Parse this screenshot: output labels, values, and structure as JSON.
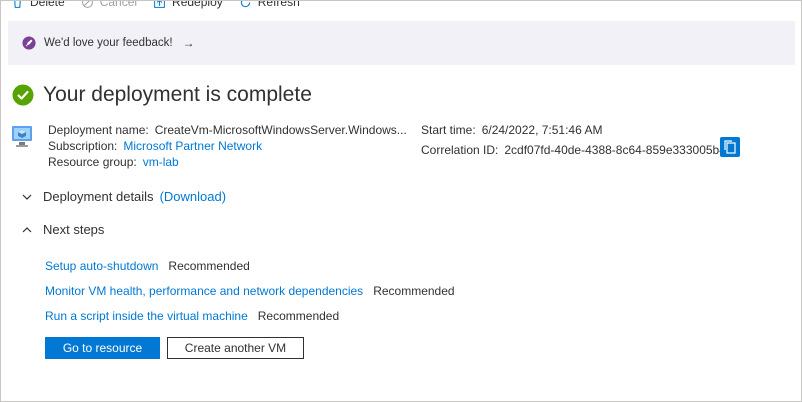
{
  "toolbar": {
    "items": [
      {
        "label": "Delete",
        "icon": "trash-icon",
        "enabled": true
      },
      {
        "label": "Cancel",
        "icon": "cancel-icon",
        "enabled": false
      },
      {
        "label": "Redeploy",
        "icon": "upload-icon",
        "enabled": true
      },
      {
        "label": "Refresh",
        "icon": "refresh-icon",
        "enabled": true
      }
    ]
  },
  "banner": {
    "text": "We'd love your feedback!",
    "arrow": "→",
    "icon": "rocket-icon"
  },
  "status": {
    "title": "Your deployment is complete",
    "icon": "success-check-icon",
    "color": "#57a300"
  },
  "deployment": {
    "name_label": "Deployment name:",
    "name_value": "CreateVm-MicrosoftWindowsServer.Windows...",
    "subscription_label": "Subscription:",
    "subscription_value": "Microsoft Partner Network",
    "resource_group_label": "Resource group:",
    "resource_group_value": "vm-lab",
    "start_time_label": "Start time:",
    "start_time_value": "6/24/2022, 7:51:46 AM",
    "correlation_label": "Correlation ID:",
    "correlation_value": "2cdf07fd-40de-4388-8c64-859e333005b4"
  },
  "sections": {
    "details_label": "Deployment details",
    "download_label": "(Download)",
    "next_steps_label": "Next steps"
  },
  "next_steps": [
    {
      "link": "Setup auto-shutdown",
      "tag": "Recommended"
    },
    {
      "link": "Monitor VM health, performance and network dependencies",
      "tag": "Recommended"
    },
    {
      "link": "Run a script inside the virtual machine",
      "tag": "Recommended"
    }
  ],
  "buttons": {
    "primary": "Go to resource",
    "secondary": "Create another VM"
  },
  "colors": {
    "accent": "#0078d4",
    "banner_bg": "#f3f1f8",
    "success": "#57a300"
  }
}
